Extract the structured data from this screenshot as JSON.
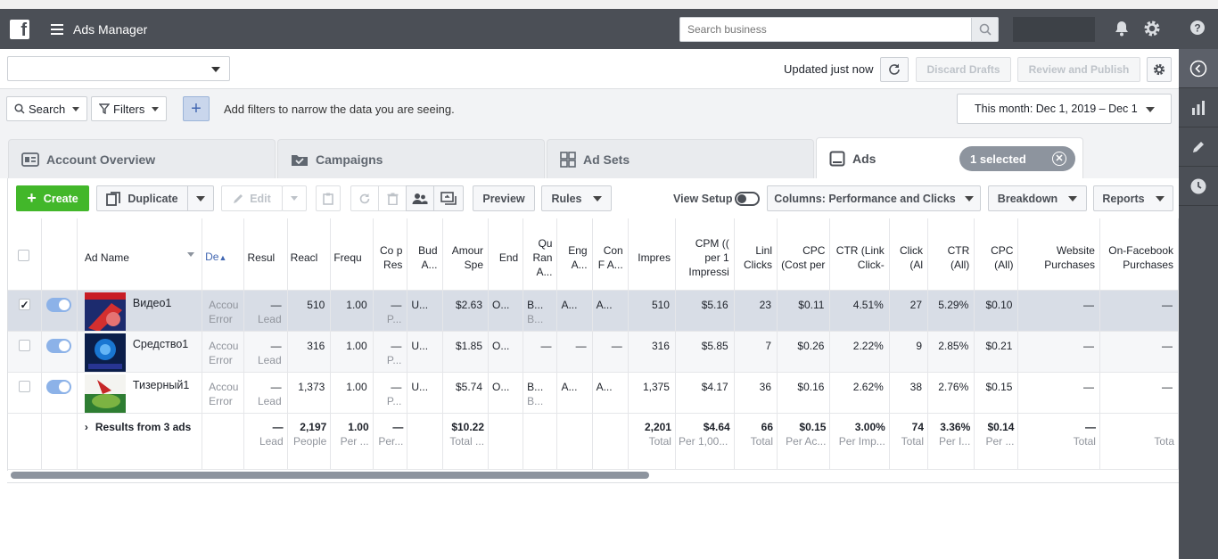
{
  "topbar": {
    "app_title": "Ads Manager",
    "search_placeholder": "Search business"
  },
  "subheader": {
    "account_selector": "",
    "updated": "Updated just now",
    "discard": "Discard Drafts",
    "review": "Review and Publish"
  },
  "filters": {
    "search": "Search",
    "filters": "Filters",
    "hint": "Add filters to narrow the data you are seeing.",
    "date_range": "This month: Dec 1, 2019 – Dec 1"
  },
  "tabs": {
    "account": "Account Overview",
    "campaigns": "Campaigns",
    "adsets": "Ad Sets",
    "ads": "Ads",
    "selected": "1 selected"
  },
  "toolbar": {
    "create": "Create",
    "duplicate": "Duplicate",
    "edit": "Edit",
    "preview": "Preview",
    "rules": "Rules",
    "view_setup": "View Setup",
    "columns": "Columns: Performance and Clicks",
    "breakdown": "Breakdown",
    "reports": "Reports"
  },
  "columns": [
    "Ad Name",
    "De",
    "Resul",
    "Reacl",
    "Frequ",
    "Co p Res",
    "Bud A...",
    "Amour Spe",
    "End",
    "Qu Ran A...",
    "Eng A...",
    "Con F A...",
    "Impres",
    "CPM (( per 1 Impressi",
    "Linl Clicks",
    "CPC (Cost per",
    "CTR (Link Click-",
    "Click (Al",
    "CTR (All)",
    "CPC (All)",
    "Website Purchases",
    "On-Facebook Purchases"
  ],
  "rows": [
    {
      "name": "Видео1",
      "delivery": "Accou",
      "delivery_sub": "Error",
      "results": "—",
      "results_sub": "Lead",
      "reach": "510",
      "freq": "1.00",
      "cpr": "—",
      "cpr_sub": "P...",
      "budget": "U...",
      "spent": "$2.63",
      "ends": "O...",
      "qr": "B...",
      "qr_sub": "B...",
      "eng": "A...",
      "conv": "A...",
      "impr": "510",
      "cpm": "$5.16",
      "link": "23",
      "cpc": "$0.11",
      "ctr": "4.51%",
      "clicks": "27",
      "ctr_all": "5.29%",
      "cpc_all": "$0.10",
      "web": "—",
      "onfb": "—",
      "checked": true
    },
    {
      "name": "Средство1",
      "delivery": "Accou",
      "delivery_sub": "Error",
      "results": "—",
      "results_sub": "Lead",
      "reach": "316",
      "freq": "1.00",
      "cpr": "—",
      "cpr_sub": "P...",
      "budget": "U...",
      "spent": "$1.85",
      "ends": "O...",
      "qr": "—",
      "qr_sub": "",
      "eng": "—",
      "conv": "—",
      "impr": "316",
      "cpm": "$5.85",
      "link": "7",
      "cpc": "$0.26",
      "ctr": "2.22%",
      "clicks": "9",
      "ctr_all": "2.85%",
      "cpc_all": "$0.21",
      "web": "—",
      "onfb": "—",
      "checked": false
    },
    {
      "name": "Тизерный1",
      "delivery": "Accou",
      "delivery_sub": "Error",
      "results": "—",
      "results_sub": "Lead",
      "reach": "1,373",
      "freq": "1.00",
      "cpr": "—",
      "cpr_sub": "P...",
      "budget": "U...",
      "spent": "$5.74",
      "ends": "O...",
      "qr": "B...",
      "qr_sub": "B...",
      "eng": "A...",
      "conv": "A...",
      "impr": "1,375",
      "cpm": "$4.17",
      "link": "36",
      "cpc": "$0.16",
      "ctr": "2.62%",
      "clicks": "38",
      "ctr_all": "2.76%",
      "cpc_all": "$0.15",
      "web": "—",
      "onfb": "—",
      "checked": false
    }
  ],
  "totals": {
    "label": "Results from 3 ads",
    "results": "—",
    "results_sub": "Lead",
    "reach": "2,197",
    "reach_sub": "People",
    "freq": "1.00",
    "freq_sub": "Per ...",
    "cpr": "—",
    "cpr_sub": "Per...",
    "spent": "$10.22",
    "spent_sub": "Total ...",
    "impr": "2,201",
    "impr_sub": "Total",
    "cpm": "$4.64",
    "cpm_sub": "Per 1,00...",
    "link": "66",
    "link_sub": "Total",
    "cpc": "$0.15",
    "cpc_sub": "Per Ac...",
    "ctr": "3.00%",
    "ctr_sub": "Per Imp...",
    "clicks": "74",
    "clicks_sub": "Total",
    "ctr_all": "3.36%",
    "ctr_all_sub": "Per I...",
    "cpc_all": "$0.14",
    "cpc_all_sub": "Per ...",
    "web": "—",
    "web_sub": "Total",
    "onfb_sub": "Tota"
  }
}
